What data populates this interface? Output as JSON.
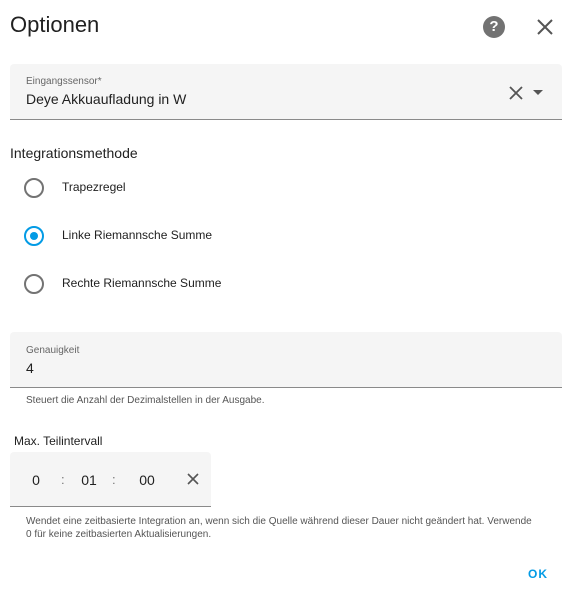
{
  "dialog": {
    "title": "Optionen",
    "help_symbol": "?",
    "help_icon": "help-circle-icon",
    "close_icon": "close-icon"
  },
  "sensor_field": {
    "label": "Eingangssensor*",
    "value": "Deye Akkuaufladung in W",
    "clear_icon": "close-icon",
    "dropdown_icon": "chevron-down-icon"
  },
  "integration": {
    "title": "Integrationsmethode",
    "options": [
      {
        "label": "Trapezregel",
        "checked": false
      },
      {
        "label": "Linke Riemannsche Summe",
        "checked": true
      },
      {
        "label": "Rechte Riemannsche Summe",
        "checked": false
      }
    ]
  },
  "precision_field": {
    "label": "Genauigkeit",
    "value": "4",
    "helper": "Steuert die Anzahl der Dezimalstellen in der Ausgabe."
  },
  "duration": {
    "title": "Max. Teilintervall",
    "hours": "0",
    "minutes": "01",
    "seconds": "00",
    "separator": ":",
    "clear_icon": "close-icon",
    "helper": "Wendet eine zeitbasierte Integration an, wenn sich die Quelle während dieser Dauer nicht geändert hat. Verwende 0 für keine zeitbasierten Aktualisierungen."
  },
  "actions": {
    "ok_label": "OK"
  },
  "colors": {
    "accent": "#039be5",
    "field_background": "#f5f5f5"
  }
}
